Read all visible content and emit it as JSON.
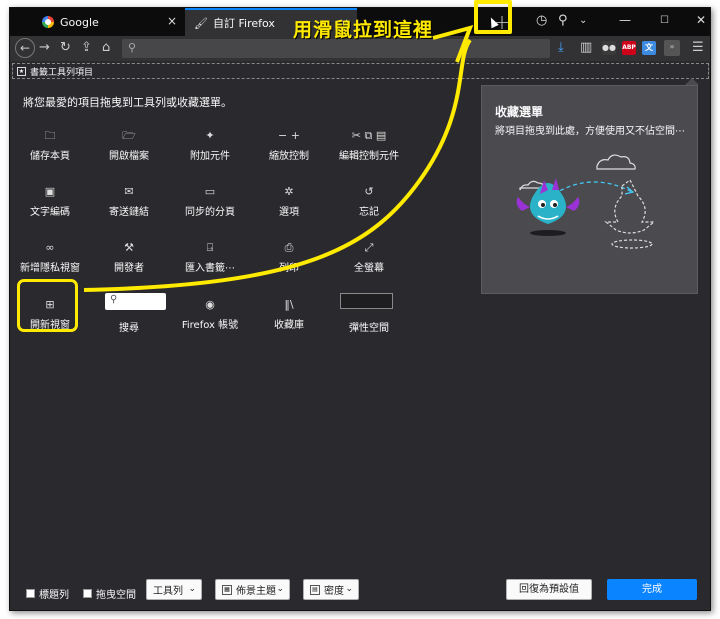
{
  "tabs": [
    {
      "label": "Google",
      "icon": "google-icon",
      "close": "×"
    },
    {
      "label": "自訂 Firefox",
      "icon": "brush-icon",
      "close": "×"
    }
  ],
  "tabbar": {
    "new_tab": "+"
  },
  "nav": {
    "back": "←",
    "forward": "→",
    "reload": "↻",
    "home": "⌂"
  },
  "bookmarks_toolbar": {
    "label": "書籤工具列項目"
  },
  "customize": {
    "hint": "將您最愛的項目拖曳到工具列或收藏選單。",
    "items": [
      {
        "label": "儲存本頁",
        "icon": "save-page-icon",
        "glyph": "🗀"
      },
      {
        "label": "開啟檔案",
        "icon": "open-file-icon",
        "glyph": "🗁"
      },
      {
        "label": "附加元件",
        "icon": "puzzle-icon",
        "glyph": "✦"
      },
      {
        "label": "縮放控制",
        "icon": "zoom-icon",
        "glyph": "− +"
      },
      {
        "label": "編輯控制元件",
        "icon": "edit-icon",
        "glyph": "✂ ⧉ ▤"
      },
      {
        "label": "文字編碼",
        "icon": "encoding-icon",
        "glyph": "▣"
      },
      {
        "label": "寄送鏈結",
        "icon": "mail-icon",
        "glyph": "✉"
      },
      {
        "label": "同步的分頁",
        "icon": "synced-tabs-icon",
        "glyph": "▭"
      },
      {
        "label": "選項",
        "icon": "gear-icon",
        "glyph": "✲"
      },
      {
        "label": "忘記",
        "icon": "forget-icon",
        "glyph": "↺"
      },
      {
        "label": "新增隱私視窗",
        "icon": "private-window-icon",
        "glyph": "∞"
      },
      {
        "label": "開發者",
        "icon": "wrench-icon",
        "glyph": "⚒"
      },
      {
        "label": "匯入書籤⋯",
        "icon": "import-icon",
        "glyph": "⍈"
      },
      {
        "label": "列印",
        "icon": "print-icon",
        "glyph": "⎙"
      },
      {
        "label": "全螢幕",
        "icon": "fullscreen-icon",
        "glyph": "⤢"
      },
      {
        "label": "開新視窗",
        "icon": "new-window-icon",
        "glyph": "⊞"
      },
      {
        "label": "搜尋",
        "icon": "search-icon",
        "glyph": ""
      },
      {
        "label": "Firefox 帳號",
        "icon": "account-icon",
        "glyph": "◉"
      },
      {
        "label": "收藏庫",
        "icon": "library-icon",
        "glyph": "‖\\"
      },
      {
        "label": "彈性空間",
        "icon": "flexible-space-icon",
        "glyph": ""
      }
    ]
  },
  "overflow_panel": {
    "title": "收藏選單",
    "description": "將項目拖曳到此處，方便使用又不佔空間⋯"
  },
  "bottom": {
    "title_bar_label": "標題列",
    "drag_space_label": "拖曳空間",
    "toolbars_label": "工具列",
    "themes_label": "佈景主題",
    "density_label": "密度",
    "restore_label": "回復為預設值",
    "done_label": "完成"
  },
  "annotation": {
    "text": "用滑鼠拉到這裡",
    "color": "#ffea00"
  },
  "colors": {
    "accent": "#0a84ff",
    "panel": "#4a4a4f",
    "background": "#2a2a2e"
  }
}
